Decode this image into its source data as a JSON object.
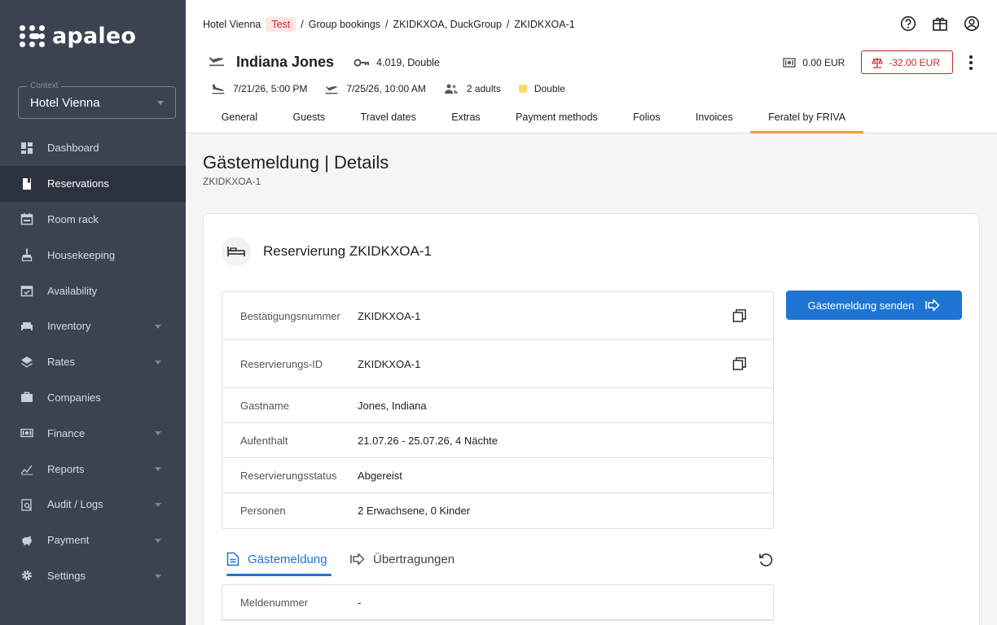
{
  "brand": {
    "name": "apaleo"
  },
  "context": {
    "legend": "Context",
    "value": "Hotel Vienna"
  },
  "sidebar": {
    "items": [
      {
        "label": "Dashboard",
        "icon": "dashboard-icon",
        "expandable": false
      },
      {
        "label": "Reservations",
        "icon": "book-icon",
        "expandable": false,
        "active": true
      },
      {
        "label": "Room rack",
        "icon": "calendar-icon",
        "expandable": false
      },
      {
        "label": "Housekeeping",
        "icon": "broom-icon",
        "expandable": false
      },
      {
        "label": "Availability",
        "icon": "calendar-check-icon",
        "expandable": false
      },
      {
        "label": "Inventory",
        "icon": "bed-icon",
        "expandable": true
      },
      {
        "label": "Rates",
        "icon": "layers-icon",
        "expandable": true
      },
      {
        "label": "Companies",
        "icon": "briefcase-icon",
        "expandable": false
      },
      {
        "label": "Finance",
        "icon": "money-icon",
        "expandable": true
      },
      {
        "label": "Reports",
        "icon": "chart-icon",
        "expandable": true
      },
      {
        "label": "Audit / Logs",
        "icon": "audit-icon",
        "expandable": true
      },
      {
        "label": "Payment",
        "icon": "piggy-bank-icon",
        "expandable": true
      },
      {
        "label": "Settings",
        "icon": "gear-icon",
        "expandable": true
      }
    ]
  },
  "breadcrumb": {
    "property": "Hotel Vienna",
    "badge": "Test",
    "sep": "/",
    "group": "Group bookings",
    "booking": "ZKIDKXOA, DuckGroup",
    "reservation": "ZKIDKXOA-1"
  },
  "reservation": {
    "guest_name": "Indiana Jones",
    "room": "4.019, Double",
    "balance": "0.00 EUR",
    "open_balance": "-32.00 EUR",
    "arrival": "7/21/26, 5:00 PM",
    "departure": "7/25/26, 10:00 AM",
    "adults": "2 adults",
    "unit_group": "Double"
  },
  "tabs": [
    "General",
    "Guests",
    "Travel dates",
    "Extras",
    "Payment methods",
    "Folios",
    "Invoices",
    "Feratel by FRIVA"
  ],
  "page": {
    "title": "Gästemeldung | Details",
    "subtitle": "ZKIDKXOA-1"
  },
  "card": {
    "title": "Reservierung ZKIDKXOA-1",
    "send_button": "Gästemeldung senden",
    "rows": [
      {
        "label": "Bestätigungsnummer",
        "value": "ZKIDKXOA-1",
        "copy": true
      },
      {
        "label": "Reservierungs-ID",
        "value": "ZKIDKXOA-1",
        "copy": true
      },
      {
        "label": "Gastname",
        "value": "Jones, Indiana",
        "copy": false
      },
      {
        "label": "Aufenthalt",
        "value": "21.07.26 - 25.07.26, 4 Nächte",
        "copy": false
      },
      {
        "label": "Reservierungsstatus",
        "value": "Abgereist",
        "copy": false
      },
      {
        "label": "Personen",
        "value": "2 Erwachsene, 0 Kinder",
        "copy": false
      }
    ],
    "subtabs": [
      {
        "label": "Gästemeldung",
        "icon": "document-icon"
      },
      {
        "label": "Übertragungen",
        "icon": "send-arrow-icon"
      }
    ],
    "report_rows": [
      {
        "label": "Meldenummer",
        "value": "-"
      }
    ]
  },
  "colors": {
    "sidebar": "#3b4252",
    "accent": "#1e74d3",
    "tab_indicator": "#f09a3e",
    "danger": "#c62828"
  }
}
